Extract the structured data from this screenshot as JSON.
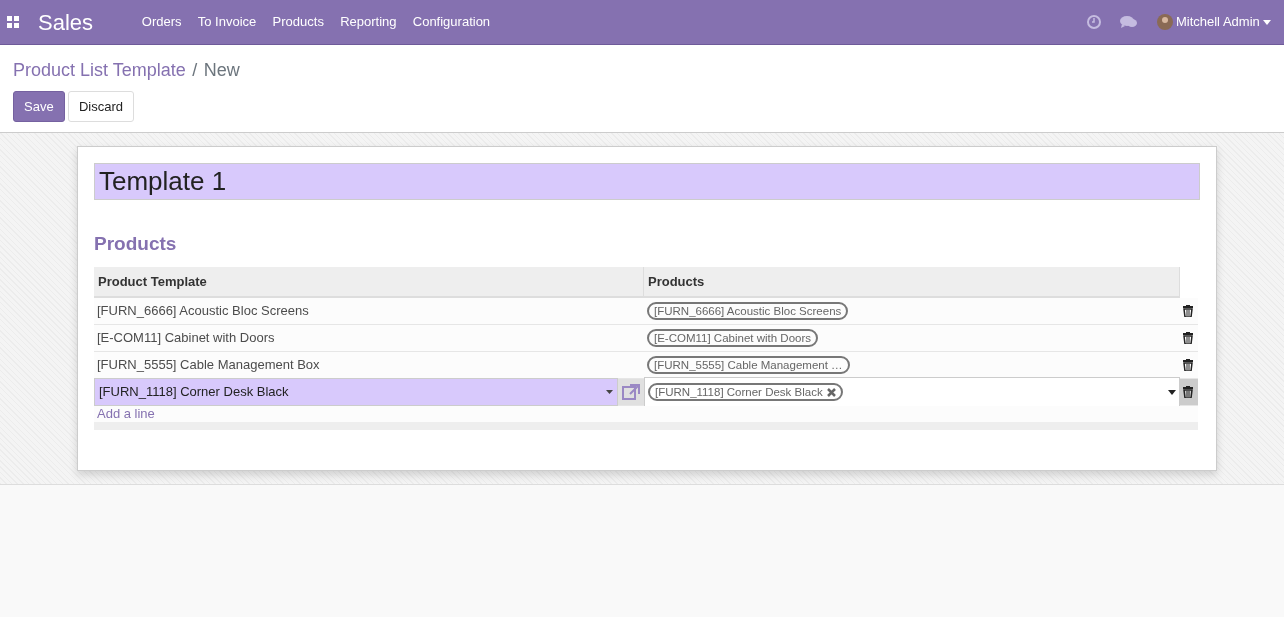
{
  "navbar": {
    "app_name": "Sales",
    "menu": [
      "Orders",
      "To Invoice",
      "Products",
      "Reporting",
      "Configuration"
    ],
    "user": "Mitchell Admin"
  },
  "breadcrumb": {
    "parent": "Product List Template",
    "separator": "/",
    "current": "New"
  },
  "buttons": [
    {
      "label": "Save",
      "kind": "primary"
    },
    {
      "label": "Discard",
      "kind": "secondary"
    }
  ],
  "form": {
    "name": "Template 1",
    "section_title": "Products",
    "table": {
      "columns": [
        "Product Template",
        "Products"
      ],
      "rows": [
        {
          "product_template": "[FURN_6666] Acoustic Bloc Screens",
          "products": [
            "[FURN_6666] Acoustic Bloc Screens"
          ],
          "editing": false
        },
        {
          "product_template": "[E-COM11] Cabinet with Doors",
          "products": [
            "[E-COM11] Cabinet with Doors"
          ],
          "editing": false
        },
        {
          "product_template": "[FURN_5555] Cable Management Box",
          "products": [
            "[FURN_5555] Cable Management …"
          ],
          "editing": false
        },
        {
          "product_template": "[FURN_1118] Corner Desk Black",
          "products": [
            "[FURN_1118] Corner Desk Black"
          ],
          "editing": true
        }
      ],
      "add_line": "Add a line"
    }
  }
}
